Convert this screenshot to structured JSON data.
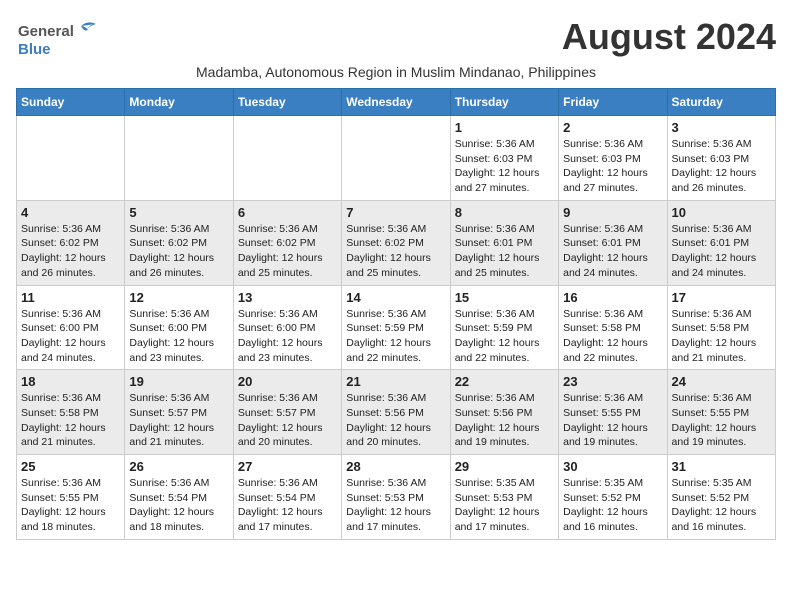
{
  "logo": {
    "line1": "General",
    "line2": "Blue"
  },
  "title": "August 2024",
  "subtitle": "Madamba, Autonomous Region in Muslim Mindanao, Philippines",
  "days_header": [
    "Sunday",
    "Monday",
    "Tuesday",
    "Wednesday",
    "Thursday",
    "Friday",
    "Saturday"
  ],
  "weeks": [
    {
      "row_class": "week-row-1",
      "days": [
        {
          "num": "",
          "info": ""
        },
        {
          "num": "",
          "info": ""
        },
        {
          "num": "",
          "info": ""
        },
        {
          "num": "",
          "info": ""
        },
        {
          "num": "1",
          "info": "Sunrise: 5:36 AM\nSunset: 6:03 PM\nDaylight: 12 hours\nand 27 minutes."
        },
        {
          "num": "2",
          "info": "Sunrise: 5:36 AM\nSunset: 6:03 PM\nDaylight: 12 hours\nand 27 minutes."
        },
        {
          "num": "3",
          "info": "Sunrise: 5:36 AM\nSunset: 6:03 PM\nDaylight: 12 hours\nand 26 minutes."
        }
      ]
    },
    {
      "row_class": "week-row-2",
      "days": [
        {
          "num": "4",
          "info": "Sunrise: 5:36 AM\nSunset: 6:02 PM\nDaylight: 12 hours\nand 26 minutes."
        },
        {
          "num": "5",
          "info": "Sunrise: 5:36 AM\nSunset: 6:02 PM\nDaylight: 12 hours\nand 26 minutes."
        },
        {
          "num": "6",
          "info": "Sunrise: 5:36 AM\nSunset: 6:02 PM\nDaylight: 12 hours\nand 25 minutes."
        },
        {
          "num": "7",
          "info": "Sunrise: 5:36 AM\nSunset: 6:02 PM\nDaylight: 12 hours\nand 25 minutes."
        },
        {
          "num": "8",
          "info": "Sunrise: 5:36 AM\nSunset: 6:01 PM\nDaylight: 12 hours\nand 25 minutes."
        },
        {
          "num": "9",
          "info": "Sunrise: 5:36 AM\nSunset: 6:01 PM\nDaylight: 12 hours\nand 24 minutes."
        },
        {
          "num": "10",
          "info": "Sunrise: 5:36 AM\nSunset: 6:01 PM\nDaylight: 12 hours\nand 24 minutes."
        }
      ]
    },
    {
      "row_class": "week-row-3",
      "days": [
        {
          "num": "11",
          "info": "Sunrise: 5:36 AM\nSunset: 6:00 PM\nDaylight: 12 hours\nand 24 minutes."
        },
        {
          "num": "12",
          "info": "Sunrise: 5:36 AM\nSunset: 6:00 PM\nDaylight: 12 hours\nand 23 minutes."
        },
        {
          "num": "13",
          "info": "Sunrise: 5:36 AM\nSunset: 6:00 PM\nDaylight: 12 hours\nand 23 minutes."
        },
        {
          "num": "14",
          "info": "Sunrise: 5:36 AM\nSunset: 5:59 PM\nDaylight: 12 hours\nand 22 minutes."
        },
        {
          "num": "15",
          "info": "Sunrise: 5:36 AM\nSunset: 5:59 PM\nDaylight: 12 hours\nand 22 minutes."
        },
        {
          "num": "16",
          "info": "Sunrise: 5:36 AM\nSunset: 5:58 PM\nDaylight: 12 hours\nand 22 minutes."
        },
        {
          "num": "17",
          "info": "Sunrise: 5:36 AM\nSunset: 5:58 PM\nDaylight: 12 hours\nand 21 minutes."
        }
      ]
    },
    {
      "row_class": "week-row-4",
      "days": [
        {
          "num": "18",
          "info": "Sunrise: 5:36 AM\nSunset: 5:58 PM\nDaylight: 12 hours\nand 21 minutes."
        },
        {
          "num": "19",
          "info": "Sunrise: 5:36 AM\nSunset: 5:57 PM\nDaylight: 12 hours\nand 21 minutes."
        },
        {
          "num": "20",
          "info": "Sunrise: 5:36 AM\nSunset: 5:57 PM\nDaylight: 12 hours\nand 20 minutes."
        },
        {
          "num": "21",
          "info": "Sunrise: 5:36 AM\nSunset: 5:56 PM\nDaylight: 12 hours\nand 20 minutes."
        },
        {
          "num": "22",
          "info": "Sunrise: 5:36 AM\nSunset: 5:56 PM\nDaylight: 12 hours\nand 19 minutes."
        },
        {
          "num": "23",
          "info": "Sunrise: 5:36 AM\nSunset: 5:55 PM\nDaylight: 12 hours\nand 19 minutes."
        },
        {
          "num": "24",
          "info": "Sunrise: 5:36 AM\nSunset: 5:55 PM\nDaylight: 12 hours\nand 19 minutes."
        }
      ]
    },
    {
      "row_class": "week-row-5",
      "days": [
        {
          "num": "25",
          "info": "Sunrise: 5:36 AM\nSunset: 5:55 PM\nDaylight: 12 hours\nand 18 minutes."
        },
        {
          "num": "26",
          "info": "Sunrise: 5:36 AM\nSunset: 5:54 PM\nDaylight: 12 hours\nand 18 minutes."
        },
        {
          "num": "27",
          "info": "Sunrise: 5:36 AM\nSunset: 5:54 PM\nDaylight: 12 hours\nand 17 minutes."
        },
        {
          "num": "28",
          "info": "Sunrise: 5:36 AM\nSunset: 5:53 PM\nDaylight: 12 hours\nand 17 minutes."
        },
        {
          "num": "29",
          "info": "Sunrise: 5:35 AM\nSunset: 5:53 PM\nDaylight: 12 hours\nand 17 minutes."
        },
        {
          "num": "30",
          "info": "Sunrise: 5:35 AM\nSunset: 5:52 PM\nDaylight: 12 hours\nand 16 minutes."
        },
        {
          "num": "31",
          "info": "Sunrise: 5:35 AM\nSunset: 5:52 PM\nDaylight: 12 hours\nand 16 minutes."
        }
      ]
    }
  ]
}
